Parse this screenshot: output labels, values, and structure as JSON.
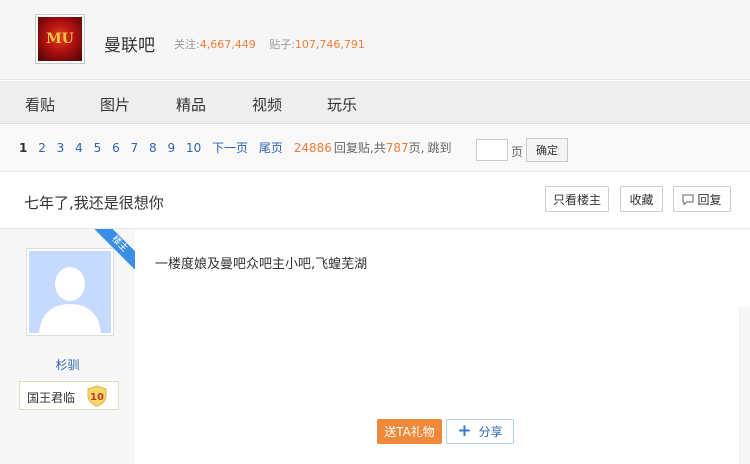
{
  "header": {
    "forum_name": "曼联吧",
    "follow_label": "关注:",
    "follow_count": "4,667,449",
    "posts_label": "贴子:",
    "posts_count": "107,746,791",
    "logo_icon": "manchester-united-crest"
  },
  "nav": {
    "items": [
      "看贴",
      "图片",
      "精品",
      "视频",
      "玩乐"
    ]
  },
  "pager": {
    "current": "1",
    "pages": [
      "2",
      "3",
      "4",
      "5",
      "6",
      "7",
      "8",
      "9",
      "10"
    ],
    "next": "下一页",
    "last": "尾页",
    "reply_count": "24886",
    "reply_label": "回复贴,共",
    "total_pages": "787",
    "page_unit": "页,",
    "jump_label": "跳到",
    "jump_unit": "页",
    "jump_value": "",
    "confirm": "确定"
  },
  "thread": {
    "title": "七年了,我还是很想你",
    "only_op": "只看楼主",
    "favorite": "收藏",
    "reply": "回复",
    "reply_icon": "comment-icon"
  },
  "post": {
    "op_ribbon": "楼主",
    "author": "杉驯",
    "badge_title": "国王君临",
    "badge_level": "10",
    "text": "一楼度娘及曼吧众吧主小吧,飞蝗芜湖",
    "gift_button": "送TA礼物",
    "share_button": "分享"
  },
  "colors": {
    "accent_orange": "#f07c3a",
    "link_blue": "#2d64b3",
    "avatar_bg": "#c6d9ff"
  }
}
